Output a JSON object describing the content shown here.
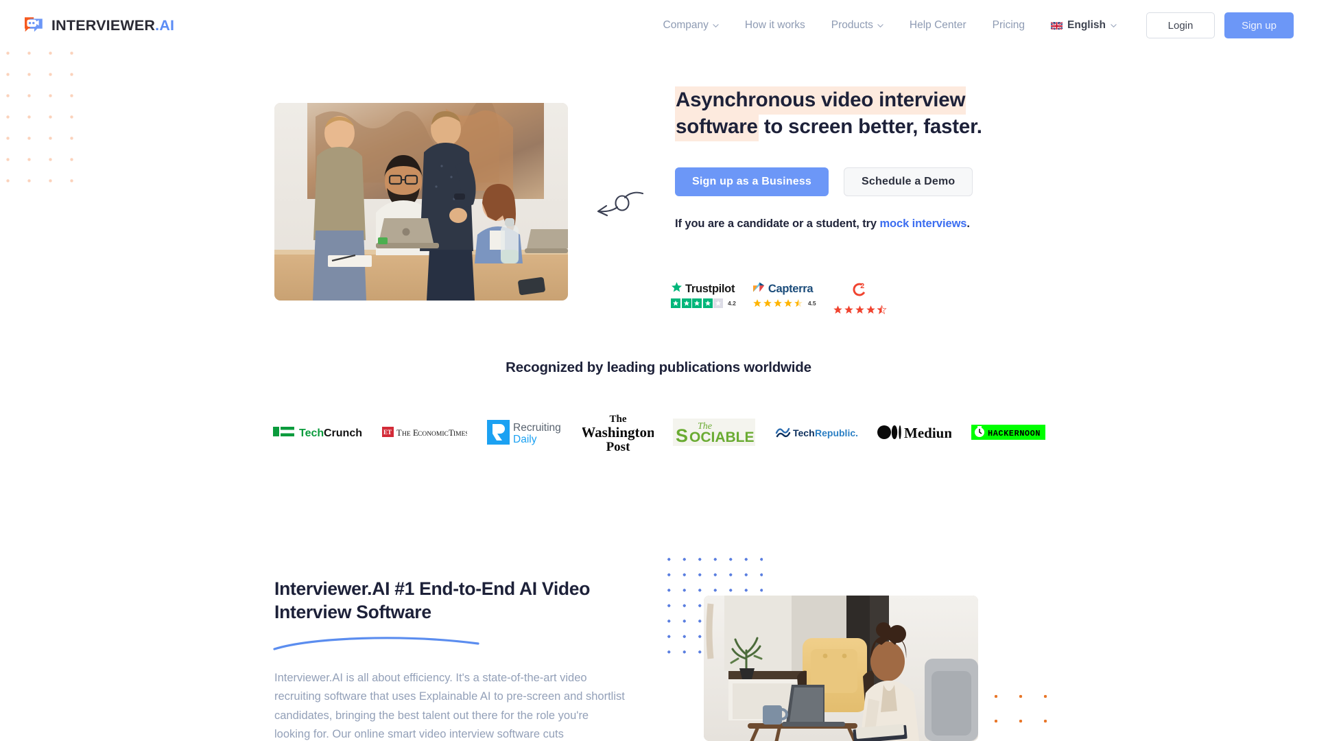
{
  "brand": {
    "logo_text_main": "INTERVIEWER",
    "logo_text_accent": ".AI",
    "logo_icon": "chat-bubble-video-icon",
    "accent_blue": "#6c97f7",
    "accent_orange": "#f5591f",
    "highlight_peach": "#fdeade",
    "text_dark": "#1d2139",
    "text_muted": "#93a0b8"
  },
  "header": {
    "nav": [
      {
        "label": "Company",
        "has_dropdown": true,
        "icon": "chevron-down-icon"
      },
      {
        "label": "How it works",
        "has_dropdown": false
      },
      {
        "label": "Products",
        "has_dropdown": true,
        "icon": "chevron-down-icon"
      },
      {
        "label": "Help Center",
        "has_dropdown": false
      },
      {
        "label": "Pricing",
        "has_dropdown": false
      }
    ],
    "language": {
      "label": "English",
      "flag": "uk-flag-icon",
      "icon": "chevron-down-icon"
    },
    "login_label": "Login",
    "signup_label": "Sign up"
  },
  "hero": {
    "headline_highlight": "Asynchronous video interview software",
    "headline_rest": " to screen better, faster.",
    "primary_cta": "Sign up as a Business",
    "secondary_cta": "Schedule a Demo",
    "candidate_prefix": "If you are a candidate or a student, try ",
    "candidate_link": "mock interviews",
    "candidate_suffix": ".",
    "photo_alt": "team-around-laptop-photo",
    "arrow_icon": "curly-arrow-left-icon"
  },
  "reviews": [
    {
      "name": "Trustpilot",
      "icon": "trustpilot-star-icon",
      "score": "4.2",
      "stars": 4.2,
      "style": "boxes",
      "color": "#00b67a"
    },
    {
      "name": "Capterra",
      "icon": "capterra-logo-icon",
      "score": "4.5",
      "stars": 4.5,
      "style": "stars",
      "color": "#ffa726"
    },
    {
      "name": "",
      "icon": "g2-logo-icon",
      "score": "",
      "stars": 4.5,
      "style": "stars",
      "color": "#f0432f"
    }
  ],
  "publications": {
    "title": "Recognized by leading publications worldwide",
    "logos": [
      {
        "name": "TechCrunch",
        "icon": "techcrunch-logo"
      },
      {
        "name": "THE ECONOMIC TIMES",
        "icon": "economic-times-logo"
      },
      {
        "name": "Recruiting Daily",
        "icon": "recruiting-daily-logo"
      },
      {
        "name": "The Washington Post",
        "icon": "washington-post-logo"
      },
      {
        "name": "The SOCIABLE",
        "icon": "sociable-logo"
      },
      {
        "name": "TechRepublic.",
        "icon": "techrepublic-logo"
      },
      {
        "name": "Medium",
        "icon": "medium-logo"
      },
      {
        "name": "HACKERNOON",
        "icon": "hackernoon-logo"
      }
    ]
  },
  "section_two": {
    "title": "Interviewer.AI #1 End-to-End AI Video Interview Software",
    "body": "Interviewer.AI is all about efficiency. It's a state-of-the-art video recruiting software that uses Explainable AI to pre-screen and shortlist candidates, bringing the best talent out there for the role you're looking for. Our online smart video interview software cuts",
    "photo_alt": "woman-with-laptop-photo",
    "underline_icon": "blue-swoosh-underline"
  }
}
